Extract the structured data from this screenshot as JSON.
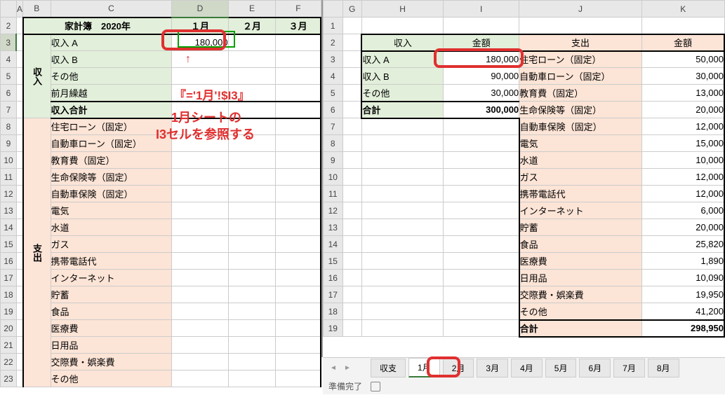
{
  "colHeadersLeft": [
    "A",
    "B",
    "C",
    "D",
    "E",
    "F"
  ],
  "rowHeadersLeft": [
    "2",
    "3",
    "4",
    "5",
    "6",
    "7",
    "8",
    "9",
    "10",
    "11",
    "12",
    "13",
    "14",
    "15",
    "16",
    "17",
    "18",
    "19",
    "20",
    "21",
    "22",
    "23"
  ],
  "colHeadersRight": [
    "G",
    "H",
    "I",
    "J",
    "K"
  ],
  "rowHeadersRight": [
    "1",
    "2",
    "3",
    "4",
    "5",
    "6",
    "7",
    "8",
    "9",
    "10",
    "11",
    "12",
    "13",
    "14",
    "15",
    "16",
    "17",
    "18",
    "19"
  ],
  "left": {
    "title": "家計簿　2020年",
    "months": [
      "１月",
      "２月",
      "３月"
    ],
    "incomeLabel": "収入",
    "expenseLabel": "支出",
    "incomeRows": [
      "収入 A",
      "収入 B",
      "その他",
      "前月繰越"
    ],
    "incomeTotal": "収入合計",
    "d3": "180,000",
    "expenseRows": [
      "住宅ローン（固定）",
      "自動車ローン（固定）",
      "教育費（固定）",
      "生命保険等（固定）",
      "自動車保険（固定）",
      "電気",
      "水道",
      "ガス",
      "携帯電話代",
      "インターネット",
      "貯蓄",
      "食品",
      "医療費",
      "日用品",
      "交際費・娯楽費",
      "その他"
    ]
  },
  "right": {
    "incomeHdr": "収入",
    "amountHdr": "金額",
    "expenseHdr": "支出",
    "incomeRows": [
      {
        "label": "収入 A",
        "val": "180,000"
      },
      {
        "label": "収入 B",
        "val": "90,000"
      },
      {
        "label": "その他",
        "val": "30,000"
      }
    ],
    "incomeTotal": {
      "label": "合計",
      "val": "300,000"
    },
    "expenseRows": [
      {
        "label": "住宅ローン（固定）",
        "val": "50,000"
      },
      {
        "label": "自動車ローン（固定）",
        "val": "30,000"
      },
      {
        "label": "教育費（固定）",
        "val": "13,000"
      },
      {
        "label": "生命保険等（固定）",
        "val": "20,000"
      },
      {
        "label": "自動車保険（固定）",
        "val": "12,000"
      },
      {
        "label": "電気",
        "val": "15,000"
      },
      {
        "label": "水道",
        "val": "10,000"
      },
      {
        "label": "ガス",
        "val": "12,000"
      },
      {
        "label": "携帯電話代",
        "val": "12,000"
      },
      {
        "label": "インターネット",
        "val": "6,000"
      },
      {
        "label": "貯蓄",
        "val": "20,000"
      },
      {
        "label": "食品",
        "val": "25,820"
      },
      {
        "label": "医療費",
        "val": "1,890"
      },
      {
        "label": "日用品",
        "val": "10,090"
      },
      {
        "label": "交際費・娯楽費",
        "val": "19,950"
      },
      {
        "label": "その他",
        "val": "41,200"
      }
    ],
    "expenseTotal": {
      "label": "合計",
      "val": "298,950"
    }
  },
  "tabs": [
    "収支",
    "1月",
    "2月",
    "3月",
    "4月",
    "5月",
    "6月",
    "7月",
    "8月"
  ],
  "activeTab": "1月",
  "status": "準備完了",
  "annotation": {
    "arrow": "↑",
    "formula": "『='1月'!$I3』",
    "line1": "1月シートの",
    "line2": "I3セルを参照する"
  }
}
